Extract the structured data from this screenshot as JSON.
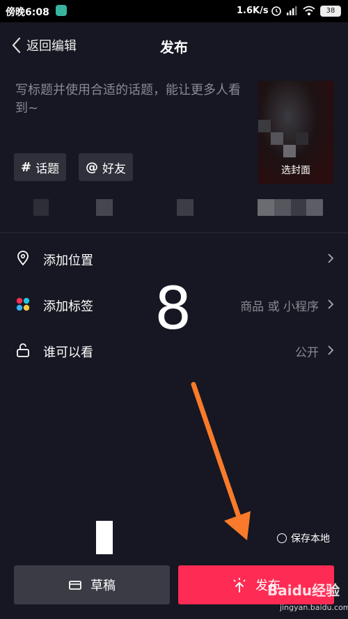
{
  "status_bar": {
    "time": "傍晚6:08",
    "net_speed": "1.6K/s",
    "battery": "38"
  },
  "header": {
    "back_label": "返回编辑",
    "title": "发布"
  },
  "caption": {
    "placeholder": "写标题并使用合适的话题，能让更多人看到~"
  },
  "cover": {
    "label": "选封面"
  },
  "chips": {
    "topic_glyph": "#",
    "topic_label": "话题",
    "friend_glyph": "@",
    "friend_label": "好友"
  },
  "rows": {
    "location": {
      "label": "添加位置"
    },
    "tag": {
      "label": "添加标签",
      "value": "商品 或 小程序"
    },
    "visibility": {
      "label": "谁可以看",
      "value": "公开"
    }
  },
  "overlay_number": "8",
  "save_local_label": "保存本地",
  "buttons": {
    "draft": "草稿",
    "publish": "发布"
  },
  "watermark": {
    "brand": "Baidu经验",
    "url": "jingyan.baidu.com"
  },
  "colors": {
    "background": "#161722",
    "publish": "#fe2c55",
    "draft": "#3a3b44",
    "arrow": "#f97a2a"
  }
}
